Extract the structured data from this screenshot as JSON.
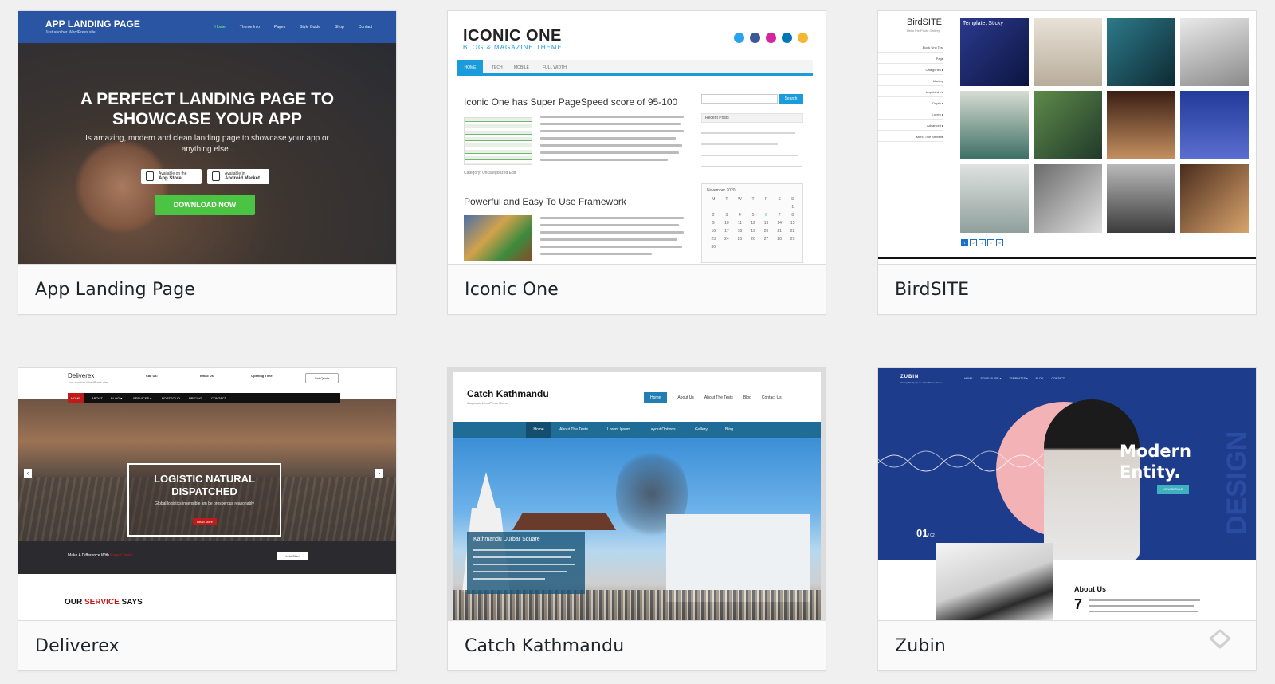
{
  "themes": [
    {
      "name": "App Landing Page",
      "preview": {
        "brand": "APP LANDING PAGE",
        "tagline": "Just another WordPress site",
        "menu": [
          "Home",
          "Theme Info",
          "Pages",
          "Style Guide",
          "Shop",
          "Contact"
        ],
        "headline_line1": "A PERFECT LANDING PAGE TO",
        "headline_line2": "SHOWCASE YOUR APP",
        "subtext": "Is amazing, modern and clean landing page to showcase your app or anything else .",
        "store1_small": "Available on the",
        "store1": "App Store",
        "store2_small": "Available in",
        "store2": "Android Market",
        "cta": "DOWNLOAD NOW"
      }
    },
    {
      "name": "Iconic One",
      "preview": {
        "logo": "ICONIC ONE",
        "logo_sub": "BLOG & MAGAZINE THEME",
        "tabs": [
          "HOME",
          "TECH",
          "MOBILE",
          "FULL WIDTH"
        ],
        "post1_title": "Iconic One has Super PageSpeed score of 95-100",
        "post1_meta": "Category: Uncategorized  Edit",
        "post2_title": "Powerful and Easy To Use Framework",
        "search_btn": "Search",
        "recent_posts": "Recent Posts",
        "calendar_title": "November 2020",
        "calendar_days": [
          "M",
          "T",
          "W",
          "T",
          "F",
          "S",
          "S"
        ]
      }
    },
    {
      "name": "BirdSITE",
      "preview": {
        "title": "BirdSITE",
        "tagline": "Hello the Photo Gallery",
        "menu": [
          "Block Unit Test",
          "Page",
          "Categories ▸",
          "Markup",
          "Unpublished",
          "Depth ▸",
          "Lorem ▸",
          "Advanced ▸",
          "Menu Title Attribute"
        ],
        "sticky_label": "Template: Sticky",
        "pager": [
          "1",
          "2",
          "3",
          "4",
          "5"
        ]
      }
    },
    {
      "name": "Deliverex",
      "preview": {
        "brand": "Deliverex",
        "brand_sub": "Just another WordPress site",
        "info1_label": "Call Us:",
        "info2_label": "Email Us:",
        "info3_label": "Opening Time:",
        "quote_btn": "Get Quote",
        "nav": [
          "HOME",
          "ABOUT",
          "BLOG ▾",
          "SERVICES ▾",
          "PORTFOLIO",
          "PRICING",
          "CONTACT"
        ],
        "hero_line1": "LOGISTIC NATURAL",
        "hero_line2": "DISPATCHED",
        "hero_sub": "Global logistics insensible am be prosperous reasonably",
        "hero_btn": "Read More",
        "strip_text": "Make A Difference With",
        "strip_em": "Expert Team",
        "strip_btn": "Lets Start",
        "service_pre": "OUR",
        "service_em": "SERVICE",
        "service_post": "SAYS"
      }
    },
    {
      "name": "Catch Kathmandu",
      "preview": {
        "title": "Catch Kathmandu",
        "subtitle": "Corporate WordPress Theme",
        "topnav": [
          "Home",
          "About Us",
          "About The Tests",
          "Blog",
          "Contact Us"
        ],
        "nav": [
          "Home",
          "About The Tests",
          "Lorem Ipsum",
          "Layout Options",
          "Gallery",
          "Blog"
        ],
        "caption_title": "Kathmandu Durbar Square"
      }
    },
    {
      "name": "Zubin",
      "preview": {
        "brand": "ZUBIN",
        "brand_sub": "Classy Multipurpose WordPress Theme",
        "menu": [
          "HOME",
          "STYLE GUIDE ▾",
          "TEMPLATES ▾",
          "BLOG",
          "CONTACT"
        ],
        "headline_line1": "Modern",
        "headline_line2": "Entity.",
        "btn": "VIEW DETAILS",
        "vertical_text": "DESIGN",
        "slide_num": "01",
        "slide_total": "/ 02",
        "about": "About Us",
        "about_num": "7"
      }
    }
  ],
  "colors": {
    "alp_blue": "#2a55a3",
    "alp_green": "#4cc443",
    "io_blue": "#1a9bdc",
    "dx_red": "#c01a1a",
    "ck_blue": "#1f6d96",
    "zb_blue": "#1e3c8c",
    "zb_pink": "#f2b2b6"
  }
}
